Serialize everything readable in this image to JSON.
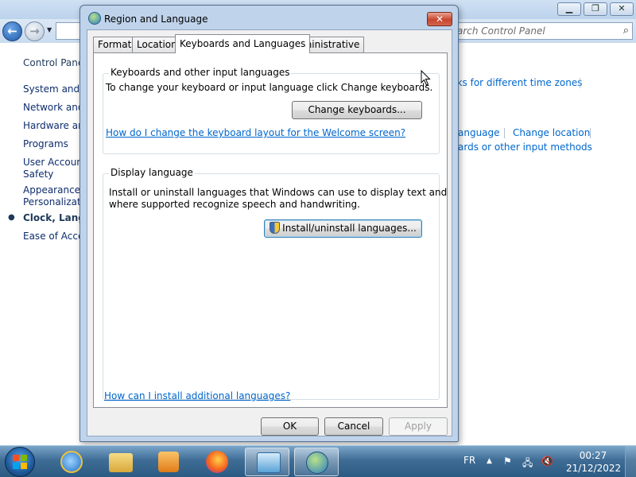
{
  "control_panel": {
    "search_placeholder": "arch Control Panel",
    "sidebar": {
      "home": "Control Panel",
      "items": [
        "System and S",
        "Network and",
        "Hardware and",
        "Programs",
        "User Account",
        "Safety",
        "Appearance a",
        "Personalizati",
        "Clock, Langu",
        "Ease of Acces"
      ]
    },
    "links": {
      "time_zones": "cks for different time zones",
      "language": "anguage",
      "change_location": "Change location",
      "input_methods": "ards or other input methods"
    }
  },
  "dialog": {
    "title": "Region and Language",
    "close_label": "✕",
    "tabs": [
      "Formats",
      "Location",
      "Keyboards and Languages",
      "Administrative"
    ],
    "active_tab": "Keyboards and Languages",
    "keyboards_group": {
      "label": "Keyboards and other input languages",
      "description": "To change your keyboard or input language click Change keyboards.",
      "button": "Change keyboards...",
      "help_link": "How do I change the keyboard layout for the Welcome screen?"
    },
    "display_group": {
      "label": "Display language",
      "description_line1": "Install or uninstall languages that Windows can use to display text and",
      "description_line2": "where supported recognize speech and handwriting.",
      "button": "Install/uninstall languages..."
    },
    "bottom_link": "How can I install additional languages?",
    "buttons": {
      "ok": "OK",
      "cancel": "Cancel",
      "apply": "Apply"
    }
  },
  "taskbar": {
    "language": "FR",
    "time": "00:27",
    "date": "21/12/2022",
    "pinned": [
      "internet-explorer",
      "file-explorer",
      "media-player",
      "firefox",
      "control-panel",
      "region-and-language"
    ]
  },
  "colors": {
    "link": "#0066cc",
    "dialog_frame": "#bfd3eb",
    "close_button": "#c8462c"
  }
}
